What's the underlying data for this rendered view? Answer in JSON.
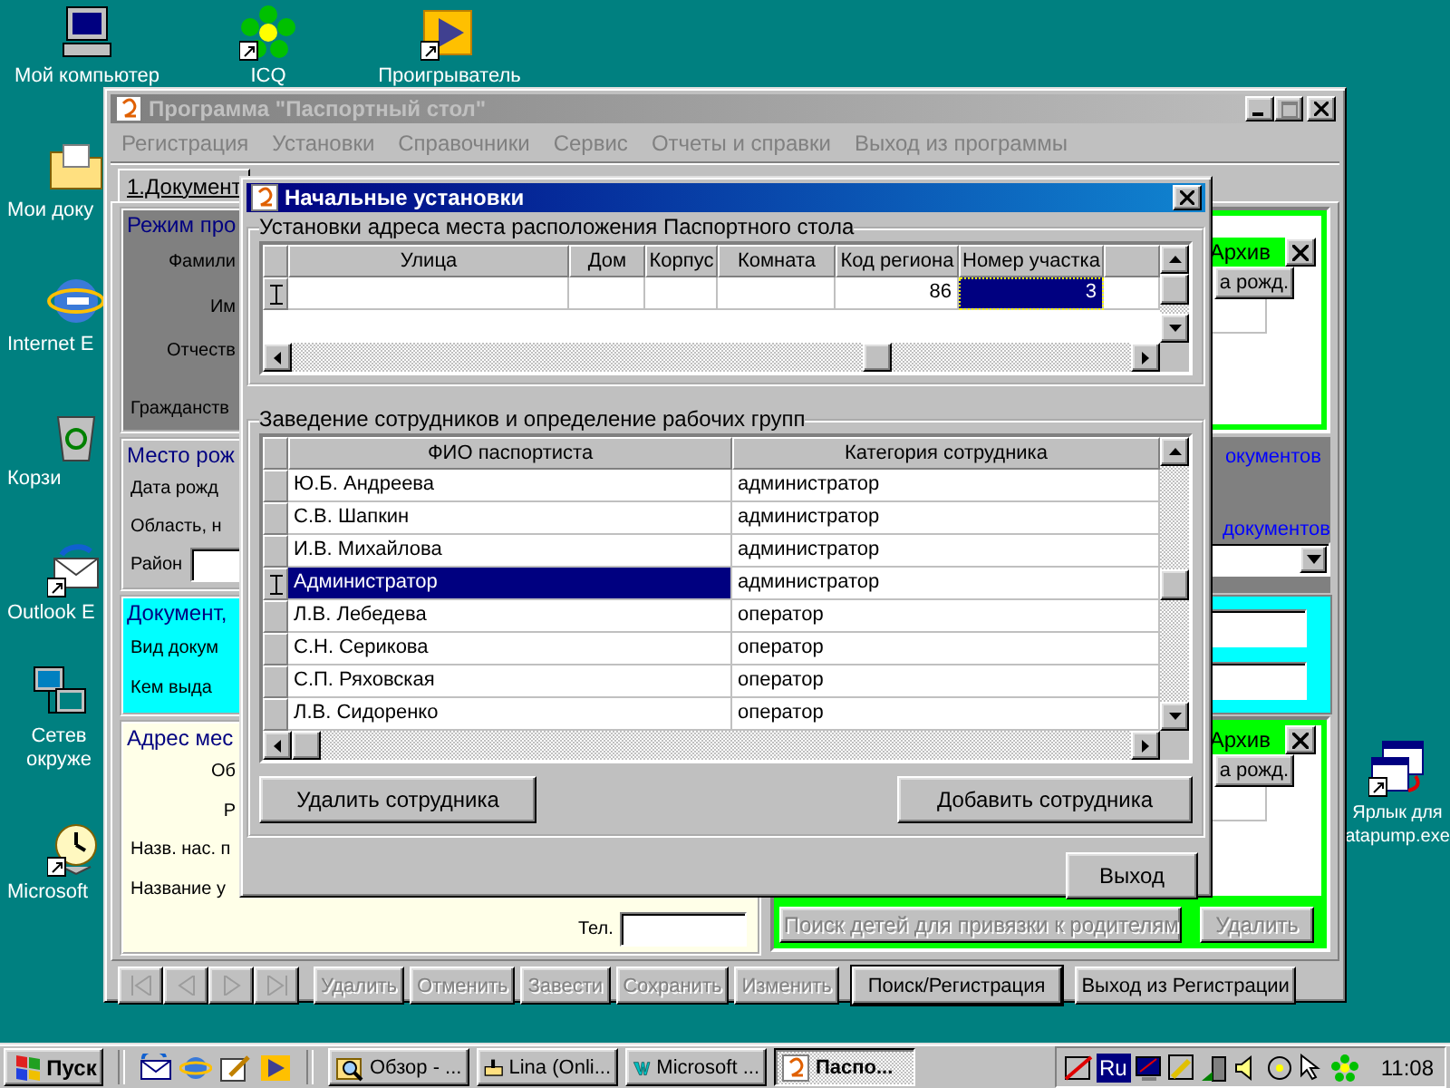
{
  "desktop_icons": [
    {
      "kind": "computer",
      "label": "Мой компьютер",
      "shortcut": false
    },
    {
      "kind": "flower",
      "label": "ICQ",
      "shortcut": true
    },
    {
      "kind": "player",
      "label": "Проигрыватель",
      "shortcut": true
    },
    {
      "kind": "folder",
      "label": "Мои доку",
      "shortcut": false
    },
    {
      "kind": "globe",
      "label": "Internet E",
      "shortcut": false
    },
    {
      "kind": "bin",
      "label": "Корзи",
      "shortcut": false
    },
    {
      "kind": "mail",
      "label": "Outlook E",
      "shortcut": true
    },
    {
      "kind": "network",
      "label": "Сетев окруже",
      "shortcut": false
    },
    {
      "kind": "clock",
      "label": "Microsoft",
      "shortcut": true
    },
    {
      "kind": "tables",
      "label": "Ярлык для atapump.exe",
      "shortcut": true
    }
  ],
  "main_window": {
    "title": "Программа \"Паспортный стол\"",
    "active": false,
    "menu": [
      "Регистрация",
      "Установки",
      "Справочники",
      "Сервис",
      "Отчеты и справки",
      "Выход из программы"
    ],
    "tabs": [
      {
        "label": "1.Документ",
        "selected": true
      }
    ],
    "left_panels": [
      {
        "kind": "gray",
        "title": "Режим про",
        "rows": [
          {
            "label": "Фамили",
            "kind": "inset",
            "field": false
          },
          {
            "label": "Им",
            "kind": "inset",
            "field": false
          },
          {
            "label": "Отчеств",
            "kind": "inset",
            "field": false
          },
          {
            "label": "Гражданств",
            "kind": "flush",
            "field": false
          }
        ]
      },
      {
        "kind": "plain",
        "title": "Место рож",
        "rows": [
          {
            "label": "Дата рожд",
            "kind": "flush",
            "field": false
          },
          {
            "label": "Область, н",
            "kind": "flush",
            "field": false
          },
          {
            "label": "Район",
            "kind": "flush",
            "field": true
          }
        ]
      },
      {
        "kind": "cyan",
        "title": "Документ,",
        "rows": [
          {
            "label": "Вид докум",
            "kind": "flush",
            "field": false
          },
          {
            "label": "Кем выда",
            "kind": "flush",
            "field": false
          }
        ]
      },
      {
        "kind": "yellow",
        "title": "Адрес мес",
        "rows": [
          {
            "label": "Об",
            "kind": "inset",
            "field": false
          },
          {
            "label": "Р",
            "kind": "inset",
            "field": false
          },
          {
            "label": "Назв. нас. п",
            "kind": "flush",
            "field": false
          },
          {
            "label": "Название у",
            "kind": "flush",
            "field": false
          }
        ],
        "phone_label": "Тел."
      }
    ],
    "archive_top": {
      "tab": "Архив",
      "button": "а рожд."
    },
    "links": [
      "окументов",
      "документов"
    ],
    "archive_bottom": {
      "tab": "Архив",
      "button": "а рожд.",
      "search_button": {
        "label": "Поиск детей для привязки к родителям",
        "disabled": true
      },
      "delete_button": {
        "label": "Удалить",
        "disabled": true
      }
    },
    "toolbar": [
      {
        "kind": "first",
        "disabled": true,
        "default": false
      },
      {
        "kind": "prev",
        "disabled": true,
        "default": false
      },
      {
        "kind": "next",
        "disabled": true,
        "default": false
      },
      {
        "kind": "last",
        "disabled": true,
        "default": false
      },
      {
        "kind": "text",
        "label": "Удалить",
        "disabled": true,
        "default": false
      },
      {
        "kind": "text",
        "label": "Отменить",
        "disabled": true,
        "default": false
      },
      {
        "kind": "text",
        "label": "Завести",
        "disabled": true,
        "default": false
      },
      {
        "kind": "text",
        "label": "Сохранить",
        "disabled": true,
        "default": false
      },
      {
        "kind": "text",
        "label": "Изменить",
        "disabled": true,
        "default": false
      },
      {
        "kind": "text",
        "label": "Поиск/Регистрация",
        "disabled": false,
        "default": true
      },
      {
        "kind": "text",
        "label": "Выход из Регистрации",
        "disabled": false,
        "default": false
      }
    ]
  },
  "dialog": {
    "title": "Начальные установки",
    "address_group": {
      "title": "Установки адреса места расположения Паспортного стола",
      "columns": [
        "Улица",
        "Дом",
        "Корпус",
        "Комната",
        "Код региона",
        "Номер участка"
      ],
      "rows": [
        {
          "current": true,
          "cells": [
            {
              "selected": false
            },
            {
              "selected": false
            },
            {
              "selected": false
            },
            {
              "selected": false
            },
            {
              "text": "86",
              "selected": false
            },
            {
              "text": "3",
              "selected": true
            }
          ]
        }
      ]
    },
    "staff_group": {
      "title": "Заведение сотрудников и определение рабочих групп",
      "columns": [
        "ФИО паспортиста",
        "Категория сотрудника"
      ],
      "rows": [
        {
          "name": "Ю.Б. Андреева",
          "category": "администратор",
          "selected": false
        },
        {
          "name": "С.В. Шапкин",
          "category": "администратор",
          "selected": false
        },
        {
          "name": "И.В. Михайлова",
          "category": "администратор",
          "selected": false
        },
        {
          "name": "Администратор",
          "category": "администратор",
          "selected": true
        },
        {
          "name": "Л.В. Лебедева",
          "category": "оператор",
          "selected": false
        },
        {
          "name": "С.Н. Серикова",
          "category": "оператор",
          "selected": false
        },
        {
          "name": "С.П. Ряховская",
          "category": "оператор",
          "selected": false
        },
        {
          "name": "Л.В. Сидоренко",
          "category": "оператор",
          "selected": false
        }
      ],
      "delete_button": "Удалить сотрудника",
      "add_button": "Добавить сотрудника"
    },
    "exit_button": "Выход"
  },
  "taskbar": {
    "start": "Пуск",
    "tasks": [
      {
        "kind": "search",
        "label": "Обзор - ...",
        "active": false
      },
      {
        "kind": "chat",
        "label": "Lina (Onli...",
        "active": false
      },
      {
        "kind": "word",
        "label": "Microsoft ...",
        "active": false
      },
      {
        "kind": "app",
        "label": "Паспо...",
        "active": true
      }
    ],
    "language": "Ru",
    "clock": "11:08"
  }
}
